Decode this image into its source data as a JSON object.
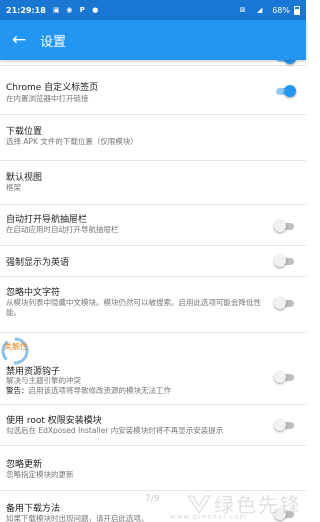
{
  "status_bar": {
    "time": "21:29:18",
    "icons": [
      "image-icon",
      "location-icon",
      "p-icon",
      "chat-icon"
    ],
    "right_icons": [
      "wifi-off-icon",
      "signal-icon"
    ],
    "battery": "68%"
  },
  "app_bar": {
    "back_icon": "arrow-left-icon",
    "title": "设置"
  },
  "settings": [
    {
      "title": "",
      "subtitle": "",
      "switch": true,
      "partial": true
    },
    {
      "title": "Chrome 自定义标签页",
      "subtitle": "在内置浏览器中打开链接",
      "switch": true
    },
    {
      "title": "下载位置",
      "subtitle": "选择 APK 文件的下载位置（仅限模块）",
      "switch": null
    },
    {
      "title": "默认视图",
      "subtitle": "框架",
      "switch": null
    },
    {
      "title": "自动打开导航抽屉栏",
      "subtitle": "在启动应用时自动打开导航抽屉栏",
      "switch": false
    },
    {
      "title": "强制显示为英语",
      "subtitle": "",
      "switch": false
    },
    {
      "title": "忽略中文字符",
      "subtitle": "从模块列表中隐藏中文模块。模块仍然可以被搜索。启用此选项可能会降低性能。",
      "switch": false
    },
    {
      "title": "禁用资源钩子",
      "subtitle": "解决与主题引擎的冲突",
      "subtitle_bold": "警告：",
      "subtitle_extra": "启用该选项将导致修改资源的模块无法工作",
      "switch": false
    },
    {
      "title": "使用 root 权限安装模块",
      "subtitle": "勾选后在 EdXposed Installer 内安装模块时将不再显示安装提示",
      "switch": false
    },
    {
      "title": "忽略更新",
      "subtitle": "忽略指定模块的更新",
      "switch": null
    },
    {
      "title": "备用下载方法",
      "subtitle": "如果下载模块时出现问题，请开启此选项。",
      "switch": false
    }
  ],
  "pager": "7/9",
  "overlay_label": "类触性",
  "watermark": {
    "text": "绿色先锋",
    "url": "www.greenxf.com",
    "logo_icon": "green-v-logo-icon"
  }
}
